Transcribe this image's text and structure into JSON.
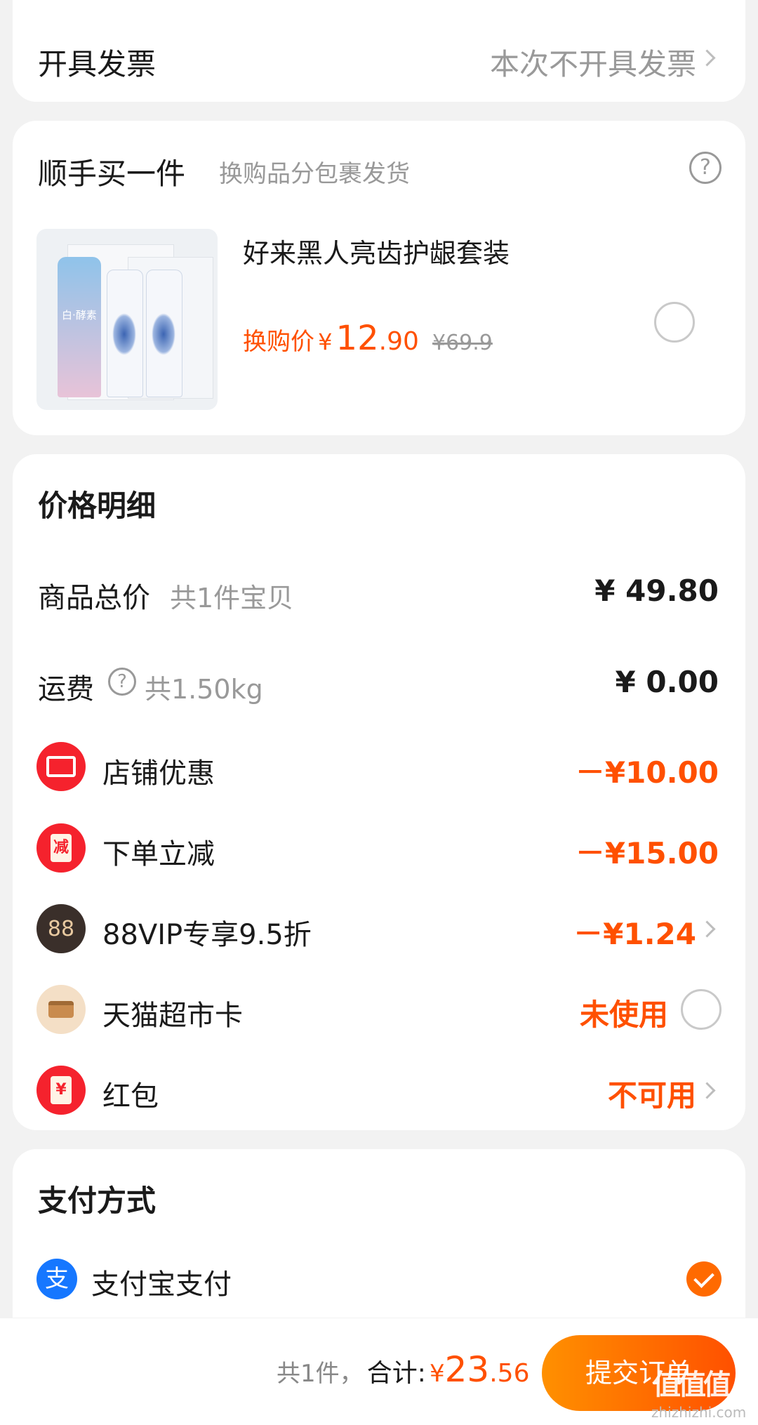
{
  "invoice": {
    "label": "开具发票",
    "value": "本次不开具发票"
  },
  "addon": {
    "title": "顺手买一件",
    "subtitle": "换购品分包裹发货",
    "product_name": "好来黑人亮齿护龈套装",
    "price_label": "换购价",
    "currency": "¥",
    "price_int": "12",
    "price_dec": ".90",
    "original_price": "¥69.9",
    "image_pack_text": "白·酵素"
  },
  "price_detail": {
    "title": "价格明细",
    "goods": {
      "label": "商品总价",
      "sub": "共1件宝贝",
      "value": "¥ 49.80"
    },
    "shipping": {
      "label": "运费",
      "sub": "共1.50kg",
      "value": "¥ 0.00"
    },
    "discounts": [
      {
        "label": "店铺优惠",
        "value": "－¥10.00",
        "icon": "coupon-icon"
      },
      {
        "label": "下单立减",
        "value": "－¥15.00",
        "icon": "instant-discount-icon",
        "icon_text": "减"
      },
      {
        "label": "88VIP专享9.5折",
        "value": "－¥1.24",
        "icon": "vip88-icon",
        "icon_text": "88"
      },
      {
        "label": "天猫超市卡",
        "value": "未使用",
        "icon": "card-icon"
      },
      {
        "label": "红包",
        "value": "不可用",
        "icon": "red-packet-icon",
        "icon_text": "¥"
      }
    ]
  },
  "payment": {
    "title": "支付方式",
    "method": "支付宝支付",
    "icon_text": "支"
  },
  "footer": {
    "count_text": "共1件，",
    "total_label": "合计:",
    "currency": "¥",
    "total_int": "23",
    "total_dec": ".56",
    "submit_label": "提交订单"
  },
  "watermark": {
    "text": "值",
    "url": "zhizhizhi.com"
  },
  "colors": {
    "accent": "#ff5000",
    "background": "#f2f2f2",
    "alipay": "#1677ff"
  }
}
